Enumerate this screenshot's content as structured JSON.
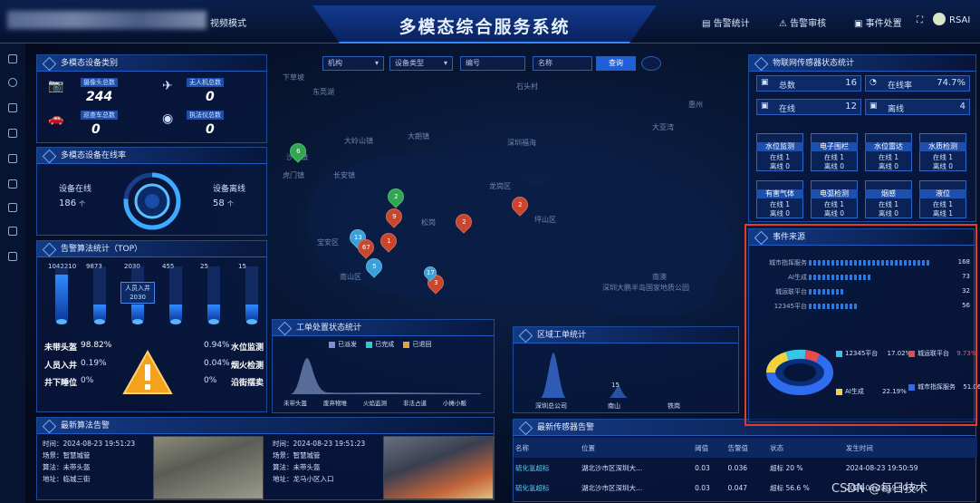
{
  "header": {
    "title": "多模态综合服务系统",
    "left_menu_fragment": "视频模式",
    "right_menu": [
      "告警统计",
      "告警审核",
      "事件处置"
    ],
    "user": "RSAI"
  },
  "sidebar": {
    "icons": [
      "list-icon",
      "alarm-icon",
      "device-icon",
      "doc-icon",
      "file-icon",
      "menu-icon",
      "layers-icon",
      "grid-icon",
      "folder-icon"
    ]
  },
  "filters": {
    "org": "机构",
    "device_type": "设备类型",
    "code_label": "编号",
    "name_label": "名称",
    "query_button": "查询"
  },
  "device_category": {
    "title": "多模态设备类别",
    "items": [
      {
        "label": "摄像头总数",
        "value": "244"
      },
      {
        "label": "无人机总数",
        "value": "0"
      },
      {
        "label": "巡查车总数",
        "value": "0"
      },
      {
        "label": "执法仪总数",
        "value": "0"
      }
    ]
  },
  "online_rate": {
    "title": "多模态设备在线率",
    "online_label": "设备在线",
    "online_value": "186",
    "online_unit": "个",
    "offline_label": "设备离线",
    "offline_value": "58",
    "offline_unit": "个"
  },
  "alarm_algo": {
    "title": "告警算法统计（TOP）",
    "values": [
      "1042210",
      "9873",
      "2030",
      "455",
      "25",
      "15"
    ],
    "bar_fractions": [
      0.85,
      0.3,
      0.3,
      0.3,
      0.3,
      0.3
    ],
    "tooltip_label": "人员入井",
    "tooltip_value": "2030",
    "rows": [
      {
        "left": "未带头盔",
        "lval": "98.82%",
        "rval": "0.94%",
        "right": "水位监测"
      },
      {
        "left": "人员入井",
        "lval": "0.19%",
        "rval": "0.04%",
        "right": "烟火检测"
      },
      {
        "left": "井下睡位",
        "lval": "0%",
        "rval": "0%",
        "right": "沿街摆卖"
      }
    ]
  },
  "iot": {
    "title": "物联网传感器状态统计",
    "summary": [
      {
        "label": "总数",
        "value": "16"
      },
      {
        "label": "在线率",
        "value": "74.7%"
      },
      {
        "label": "在线",
        "value": "12"
      },
      {
        "label": "离线",
        "value": "4"
      }
    ],
    "cells": [
      {
        "name": "水位监测",
        "online": "在线 1",
        "offline": "离线 0"
      },
      {
        "name": "电子围栏",
        "online": "在线 1",
        "offline": "离线 0"
      },
      {
        "name": "水位雷达",
        "online": "在线 1",
        "offline": "离线 0"
      },
      {
        "name": "水质检测",
        "online": "在线 1",
        "offline": "离线 0"
      },
      {
        "name": "有害气体",
        "online": "在线 1",
        "offline": "离线 0"
      },
      {
        "name": "电弧检测",
        "online": "在线 1",
        "offline": "离线 0"
      },
      {
        "name": "烟感",
        "online": "在线 1",
        "offline": "离线 0"
      },
      {
        "name": "液位",
        "online": "在线 1",
        "offline": "离线 1"
      }
    ]
  },
  "event_source": {
    "title": "事件来源",
    "rows": [
      {
        "label": "城市指挥服务",
        "value": "168",
        "frac": 0.9
      },
      {
        "label": "AI生成",
        "value": "73",
        "frac": 0.45
      },
      {
        "label": "城运联平台",
        "value": "32",
        "frac": 0.25
      },
      {
        "label": "12345平台",
        "value": "56",
        "frac": 0.35
      }
    ],
    "legend": [
      {
        "label": "12345平台",
        "value": "17.02%",
        "color": "#35c6e8"
      },
      {
        "label": "城运联平台",
        "value": "9.73%",
        "color": "#e84b4b"
      },
      {
        "label": "AI生成",
        "value": "22.19%",
        "color": "#f2d33b"
      },
      {
        "label": "城市指挥服务",
        "value": "51.06%",
        "color": "#2f6cf0"
      }
    ]
  },
  "workorder_status": {
    "title": "工单处置状态统计",
    "legend": [
      "已派发",
      "已完成",
      "已退回"
    ],
    "legend_colors": [
      "#7b8fd8",
      "#39c2c9",
      "#e2a43a"
    ],
    "categories": [
      "未带头盔",
      "废弃物堆",
      "火焰监测",
      "非法占道",
      "小摊小贩"
    ]
  },
  "region_orders": {
    "title": "区域工单统计",
    "categories": [
      "深圳总公司",
      "南山",
      "铁岗"
    ],
    "peak_label": "15"
  },
  "latest_alarm": {
    "title": "最新算法告警",
    "items": [
      {
        "time": "2024-08-23 19:51:23",
        "scene": "智慧城管",
        "algo": "未带头盔",
        "addr": "临城三街"
      },
      {
        "time": "2024-08-23 19:51:23",
        "scene": "智慧城管",
        "algo": "未带头盔",
        "addr": "龙马小区入口"
      }
    ],
    "labels": {
      "time": "时间：",
      "scene": "场景：",
      "algo": "算法：",
      "addr": "地址："
    }
  },
  "sensor_alarm": {
    "title": "最新传感器告警",
    "headers": [
      "名称",
      "位置",
      "阈值",
      "告警值",
      "状态",
      "发生时间"
    ],
    "rows": [
      {
        "name": "硫化氢超标",
        "pos": "湖北沙市区深圳大...",
        "th": "0.03",
        "val": "0.036",
        "status": "超标 20 %",
        "time": "2024-08-23 19:50:59"
      },
      {
        "name": "硫化氢超标",
        "pos": "湖北沙市区深圳大...",
        "th": "0.03",
        "val": "0.047",
        "status": "超标 56.6 %",
        "time": "2024-08-23 19:50:59"
      }
    ]
  },
  "map_labels": [
    "下草坡",
    "东莞湖",
    "大岭山镇",
    "石头村",
    "深圳福海",
    "大朗镇",
    "虎门镇",
    "长安镇",
    "沙田镇",
    "松岗",
    "大亚湾",
    "惠州",
    "深圳大鹏半岛国家地质公园",
    "坪山区",
    "南澳",
    "龙岗区",
    "南山区",
    "宝安区"
  ],
  "map_pins": [
    {
      "label": "6",
      "color": "#2ea84f"
    },
    {
      "label": "2",
      "color": "#2ea84f"
    },
    {
      "label": "9",
      "color": "#c9452e"
    },
    {
      "label": "2",
      "color": "#c9452e"
    },
    {
      "label": "2",
      "color": "#c9452e"
    },
    {
      "label": "13",
      "color": "#3aa0d8"
    },
    {
      "label": "67",
      "color": "#c9452e"
    },
    {
      "label": "1",
      "color": "#c9452e"
    },
    {
      "label": "5",
      "color": "#3aa0d8"
    },
    {
      "label": "3",
      "color": "#c9452e"
    },
    {
      "label": "17",
      "color": "#3aa0d8"
    }
  ],
  "watermark": "CSDN @每日技术"
}
